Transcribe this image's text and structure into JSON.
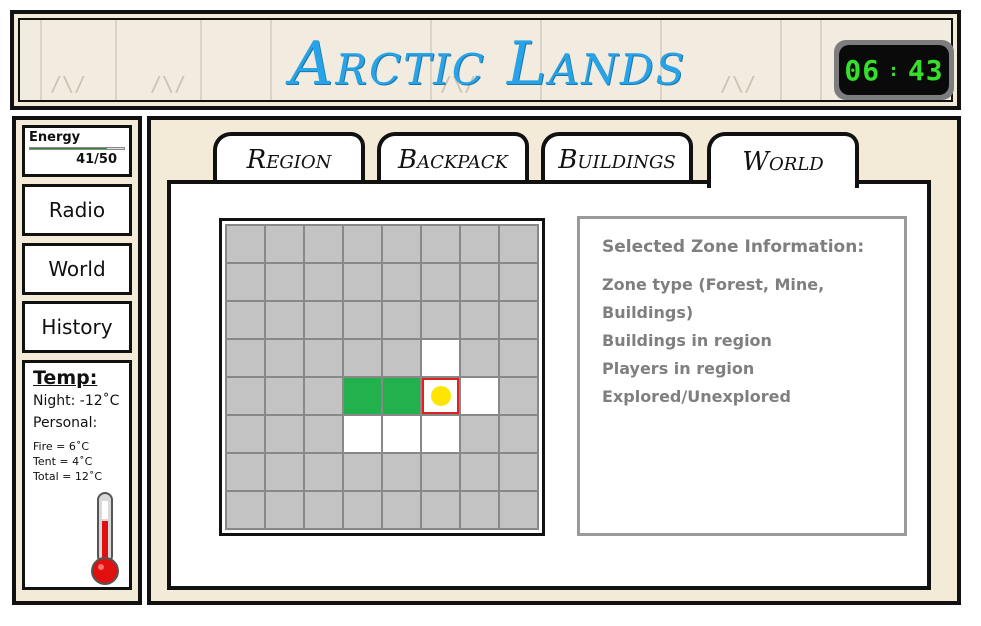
{
  "header": {
    "title": "Arctic Lands",
    "clock": {
      "hours": "06",
      "separator": ":",
      "minutes": "43",
      "color": "#35e02a"
    }
  },
  "sidebar": {
    "energy": {
      "label": "Energy",
      "current": 41,
      "max": 50,
      "value_text": "41/50"
    },
    "buttons": [
      {
        "id": "radio",
        "label": "Radio"
      },
      {
        "id": "world",
        "label": "World"
      },
      {
        "id": "history",
        "label": "History"
      }
    ],
    "temp": {
      "title": "Temp:",
      "night": "Night: -12˚C",
      "personal_label": "Personal:",
      "fire": "Fire = 6˚C",
      "tent": "Tent = 4˚C",
      "total": "Total = 12˚C"
    }
  },
  "tabs": [
    {
      "id": "region",
      "label": "Region",
      "active": false
    },
    {
      "id": "backpack",
      "label": "Backpack",
      "active": false
    },
    {
      "id": "buildings",
      "label": "Buildings",
      "active": false
    },
    {
      "id": "world",
      "label": "World",
      "active": true
    }
  ],
  "map": {
    "rows": 8,
    "cols": 8,
    "colors": {
      "unexplored": "#c3c3c3",
      "explored": "#ffffff",
      "forest": "#22b14c",
      "selected_border": "#e02020",
      "player": "#ffe600"
    },
    "special_cells": [
      {
        "row": 3,
        "col": 5,
        "state": "explored"
      },
      {
        "row": 4,
        "col": 3,
        "state": "forest"
      },
      {
        "row": 4,
        "col": 4,
        "state": "forest"
      },
      {
        "row": 4,
        "col": 5,
        "state": "selected",
        "player": true
      },
      {
        "row": 4,
        "col": 6,
        "state": "explored"
      },
      {
        "row": 5,
        "col": 3,
        "state": "explored"
      },
      {
        "row": 5,
        "col": 4,
        "state": "explored"
      },
      {
        "row": 5,
        "col": 5,
        "state": "explored"
      }
    ]
  },
  "zone_info": {
    "title": "Selected Zone Information:",
    "lines": [
      "Zone type (Forest, Mine, Buildings)",
      "Buildings in region",
      "Players in region",
      "Explored/Unexplored"
    ]
  }
}
